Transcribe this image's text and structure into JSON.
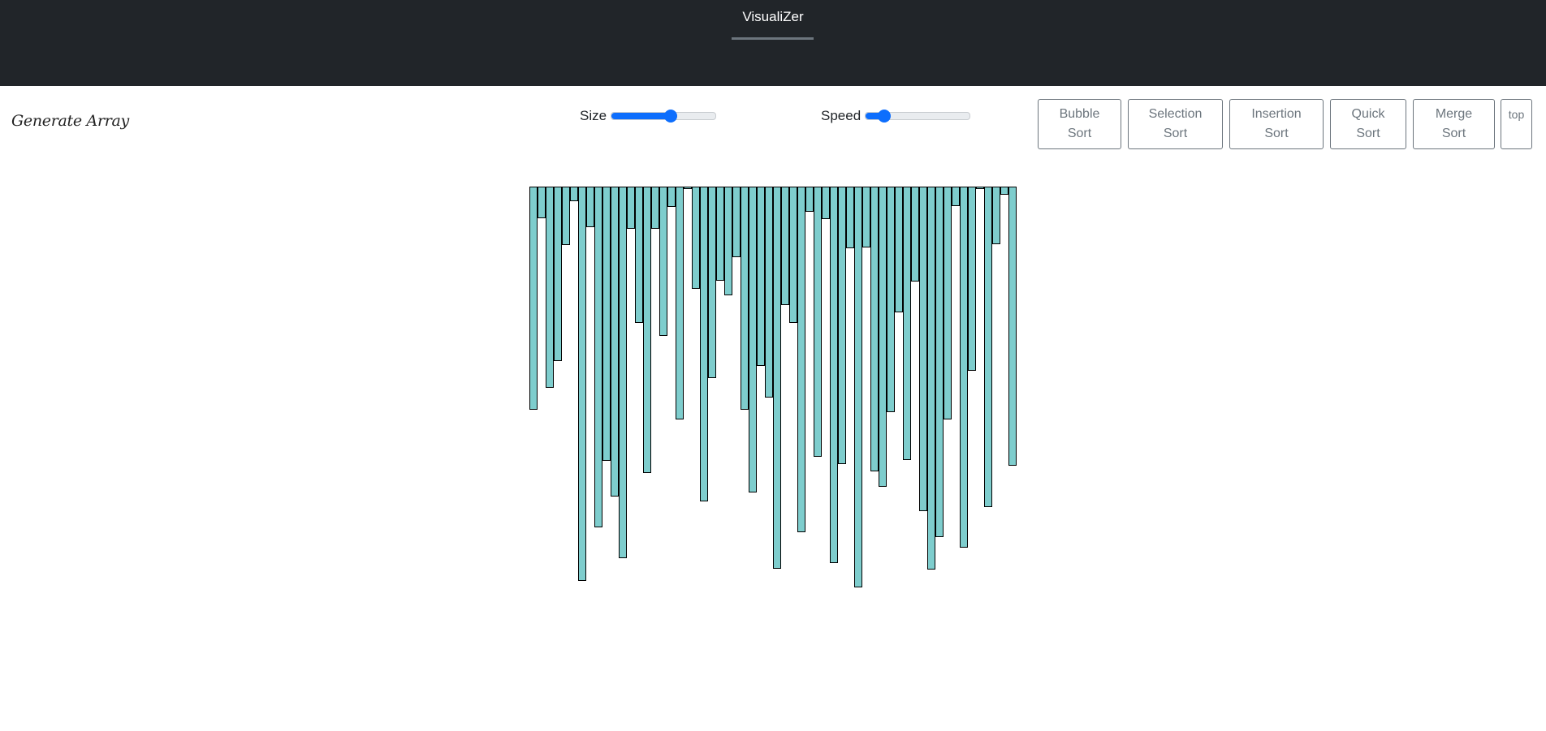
{
  "header": {
    "title": "VisualiZer"
  },
  "controls": {
    "generate_label": "Generate Array",
    "size": {
      "label": "Size",
      "value_fraction": 0.57
    },
    "speed": {
      "label": "Speed",
      "value_fraction": 0.18
    },
    "buttons": [
      {
        "label": "Bubble\nSort"
      },
      {
        "label": "Selection\nSort"
      },
      {
        "label": "Insertion\nSort"
      },
      {
        "label": "Quick\nSort"
      },
      {
        "label": "Merge\nSort"
      },
      {
        "label": "top"
      }
    ]
  },
  "colors": {
    "header_bg": "#212529",
    "bar_fill": "#7ecdcd",
    "bar_border": "#000000",
    "slider_accent": "#0d6efd",
    "button_border": "#6c757d"
  },
  "chart_data": {
    "type": "bar",
    "orientation": "hanging from top",
    "values": [
      280,
      40,
      253,
      219,
      73,
      18,
      496,
      51,
      428,
      345,
      390,
      467,
      53,
      171,
      360,
      53,
      188,
      25,
      293,
      3,
      129,
      396,
      241,
      118,
      137,
      89,
      281,
      385,
      225,
      265,
      480,
      149,
      171,
      435,
      32,
      340,
      41,
      473,
      349,
      78,
      504,
      77,
      358,
      377,
      284,
      158,
      344,
      119,
      408,
      481,
      441,
      293,
      24,
      454,
      232,
      2,
      403,
      72,
      10,
      351
    ],
    "y_max": 510
  }
}
